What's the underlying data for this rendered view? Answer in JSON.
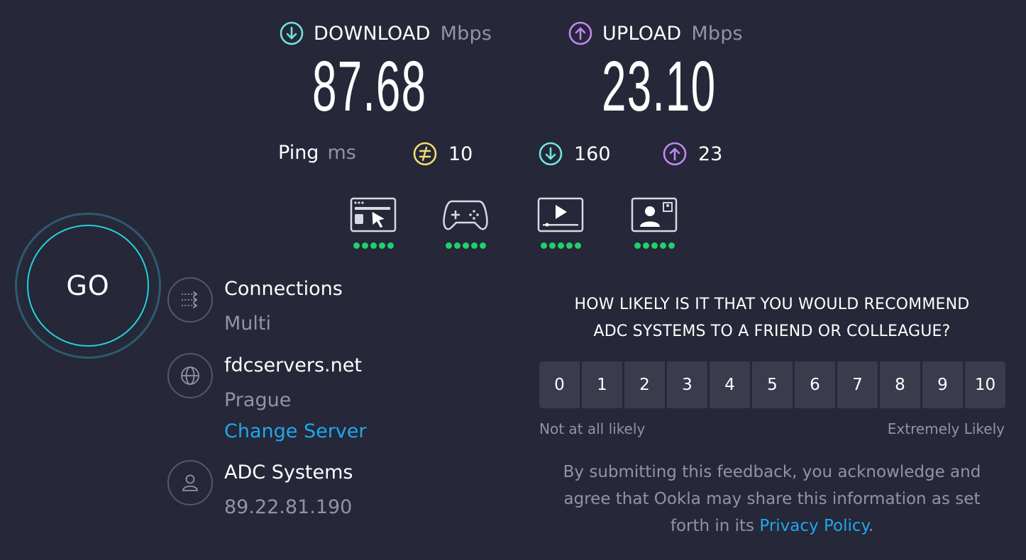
{
  "download": {
    "label": "DOWNLOAD",
    "unit": "Mbps",
    "value": "87.68",
    "icon": "download-arrow-icon",
    "color": "#6fe4e0"
  },
  "upload": {
    "label": "UPLOAD",
    "unit": "Mbps",
    "value": "23.10",
    "icon": "upload-arrow-icon",
    "color": "#c187f5"
  },
  "ping": {
    "label": "Ping",
    "unit": "ms",
    "idle": {
      "value": "10",
      "icon": "ping-idle-icon",
      "color": "#f2de6e"
    },
    "download": {
      "value": "160",
      "icon": "download-arrow-icon",
      "color": "#6fe4e0"
    },
    "upload": {
      "value": "23",
      "icon": "upload-arrow-icon",
      "color": "#c187f5"
    }
  },
  "quality": [
    {
      "name": "web-browsing-icon",
      "rating": 5
    },
    {
      "name": "gaming-icon",
      "rating": 5
    },
    {
      "name": "video-streaming-icon",
      "rating": 5
    },
    {
      "name": "video-chat-icon",
      "rating": 5
    }
  ],
  "go_button": {
    "label": "GO"
  },
  "connections": {
    "title": "Connections",
    "value": "Multi",
    "icon": "connections-icon"
  },
  "server": {
    "title": "fdcservers.net",
    "location": "Prague",
    "change_label": "Change Server",
    "icon": "globe-icon"
  },
  "provider": {
    "title": "ADC Systems",
    "ip": "89.22.81.190",
    "icon": "user-icon"
  },
  "survey": {
    "question_line1": "HOW LIKELY IS IT THAT YOU WOULD RECOMMEND",
    "question_line2": "ADC SYSTEMS TO A FRIEND OR COLLEAGUE?",
    "scale": [
      "0",
      "1",
      "2",
      "3",
      "4",
      "5",
      "6",
      "7",
      "8",
      "9",
      "10"
    ],
    "low_label": "Not at all likely",
    "high_label": "Extremely Likely",
    "disclaimer_line1": "By submitting this feedback, you acknowledge and",
    "disclaimer_line2": "agree that Ookla may share this information as set",
    "disclaimer_line3_prefix": "forth in its ",
    "privacy_link": "Privacy Policy",
    "disclaimer_suffix": "."
  },
  "colors": {
    "background": "#262738",
    "accent_link": "#1da8ec",
    "go_ring": "#23d1d8",
    "quality_dots": "#1fd06e"
  }
}
